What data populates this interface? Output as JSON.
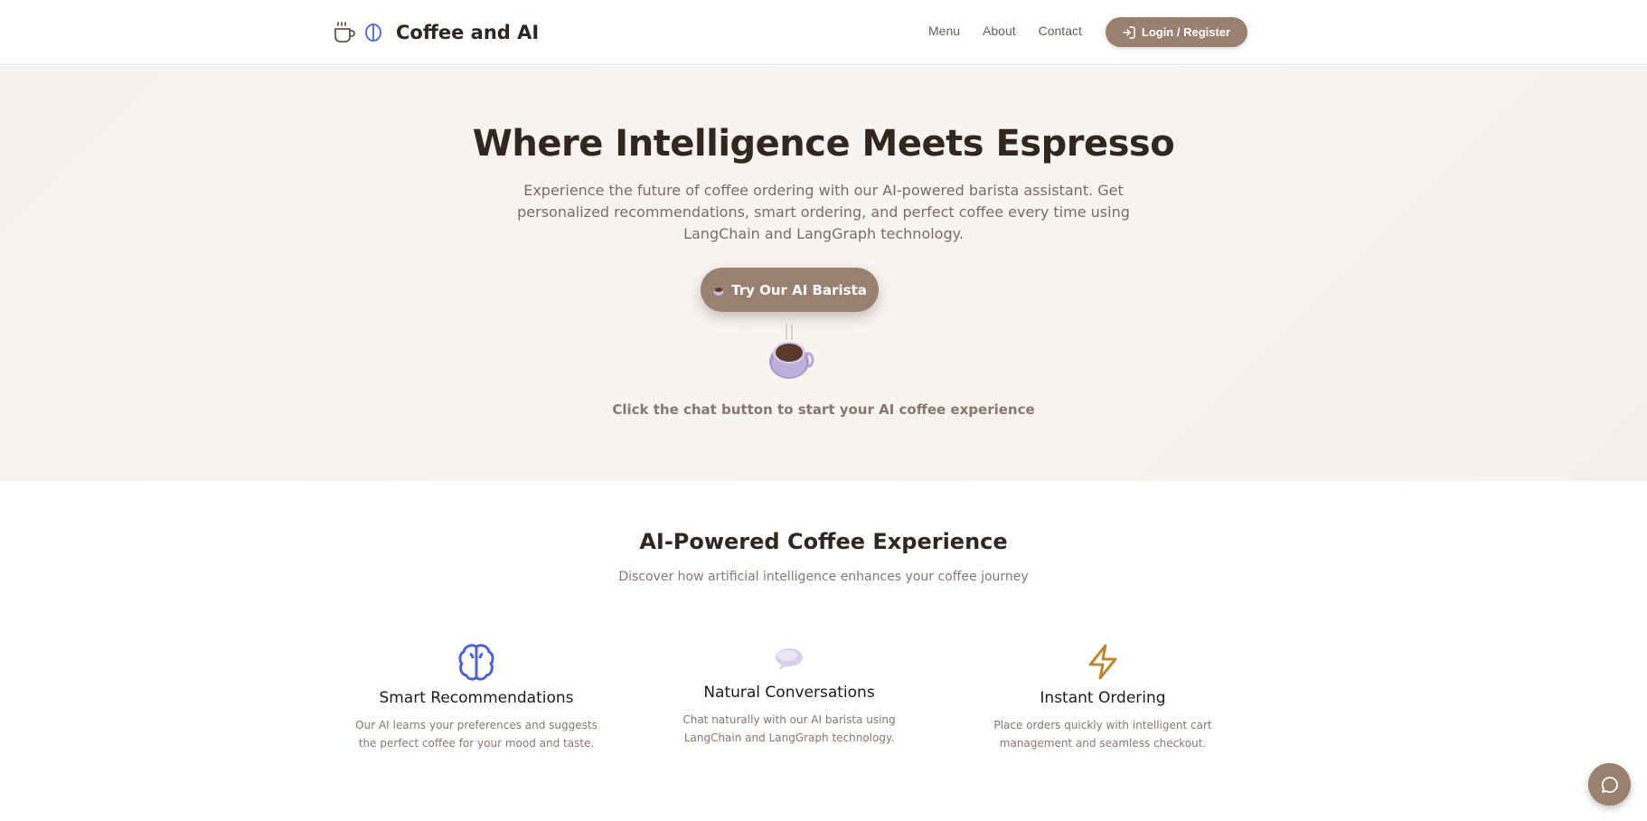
{
  "nav": {
    "brand": "Coffee and AI",
    "brand_icons": [
      "coffee-cup-icon",
      "brain-icon"
    ],
    "links": [
      "Menu",
      "About",
      "Contact"
    ],
    "login_label": "Login / Register",
    "login_icon": "login-icon"
  },
  "hero": {
    "title": "Where Intelligence Meets Espresso",
    "subtitle": "Experience the future of coffee ordering with our AI-powered barista assistant. Get personalized recommendations, smart ordering, and perfect coffee every time using LangChain and LangGraph technology.",
    "cta_label": "Try Our AI Barista",
    "cta_icon": "coffee-emoji-icon",
    "hint": "Click the chat button to start your AI coffee experience"
  },
  "features": {
    "title": "AI-Powered Coffee Experience",
    "subtitle": "Discover how artificial intelligence enhances your coffee journey",
    "cards": [
      {
        "icon": "brain-icon",
        "title": "Smart Recommendations",
        "desc_1": "Our AI learns your preferences and suggests",
        "desc_2": "the perfect coffee for your mood and taste."
      },
      {
        "icon": "speech-bubble-icon",
        "title": "Natural Conversations",
        "desc_1": "Chat naturally with our AI barista using",
        "desc_2": "LangChain and LangGraph technology."
      },
      {
        "icon": "lightning-icon",
        "title": "Instant Ordering",
        "desc_1": "Place orders quickly with intelligent cart",
        "desc_2": "management and seamless checkout."
      }
    ]
  },
  "chat_fab_icon": "chat-icon",
  "colors": {
    "accent": "#9a8071",
    "heading": "#33261f",
    "muted": "#8a766c",
    "brain_blue": "#4a63d0",
    "bolt_gold": "#b8892e"
  }
}
